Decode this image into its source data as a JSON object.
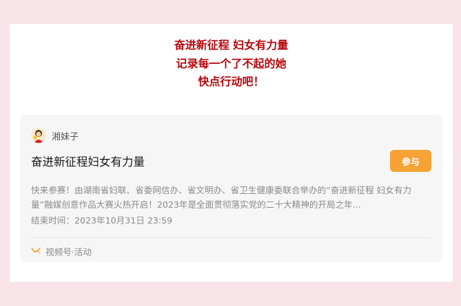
{
  "headline": {
    "lines": [
      "奋进新征程 妇女有力量",
      "记录每一个了不起的她",
      "快点行动吧！"
    ]
  },
  "embed": {
    "author": "湘妹子",
    "title": "奋进新征程妇女有力量",
    "join_label": "参与",
    "description": "快来参赛！由湖南省妇联、省委网信办、省文明办、省卫生健康委联合举办的“奋进新征程 妇女有力量”融媒创意作品大赛火热开启！2023年是全面贯彻落实党的二十大精神的开局之年...",
    "end_time": "结束时间：2023年10月31日 23:59",
    "footer_label": "视频号·活动",
    "icons": {
      "avatar": "user-avatar",
      "channel": "video-channel-icon"
    },
    "colors": {
      "accent": "#f7a234",
      "headline": "#b8060b",
      "channel_icon": "#f7a234"
    }
  }
}
